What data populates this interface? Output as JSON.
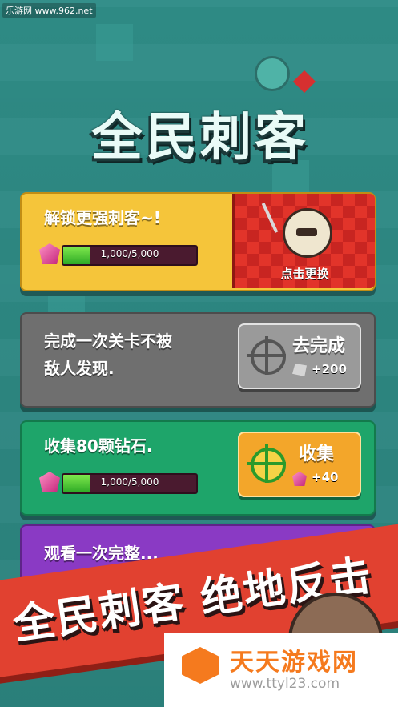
{
  "watermark": "乐游网 www.962.net",
  "title": "全民刺客",
  "tasks": [
    {
      "text": "解锁更强刺客~!",
      "progress": "1,000/5,000",
      "progress_fraction": 0.2,
      "swap_label": "点击更换"
    },
    {
      "text_line1": "完成一次关卡不被",
      "text_line2": "敌人发现.",
      "button_label": "去完成",
      "reward": "+200"
    },
    {
      "text": "收集80颗钻石.",
      "progress": "1,000/5,000",
      "progress_fraction": 0.2,
      "button_label": "收集",
      "reward": "+40"
    },
    {
      "text": "观看一次完整..."
    }
  ],
  "banner": "全民刺客 绝地反击",
  "site": {
    "name": "天天游戏网",
    "url": "www.ttyl23.com"
  },
  "colors": {
    "yellow_card": "#f5c53a",
    "gray_card": "#6f6f6f",
    "green_card": "#1ea56a",
    "purple_card": "#8a3ac4",
    "banner": "#e14130"
  }
}
